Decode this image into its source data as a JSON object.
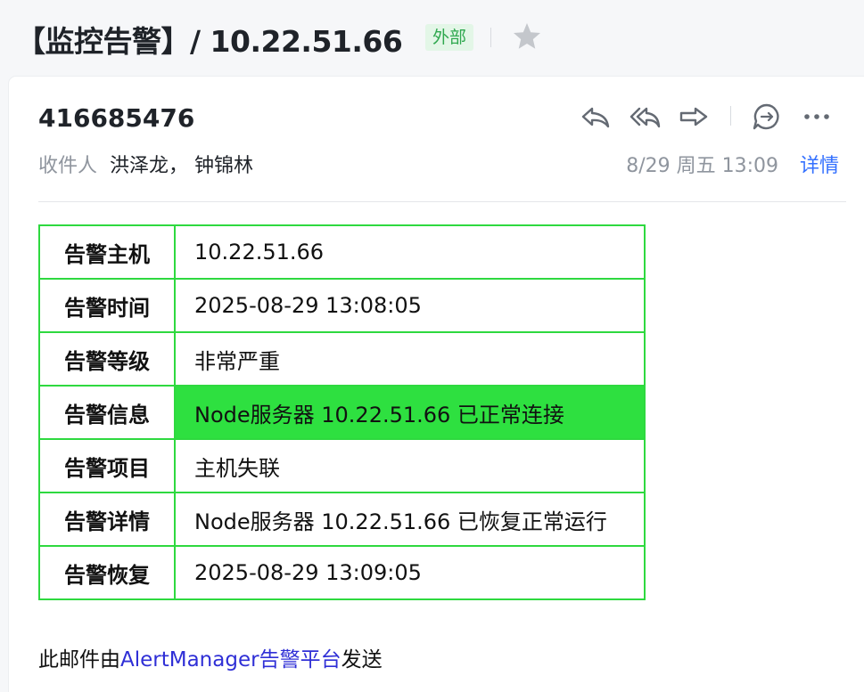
{
  "subject": {
    "title": "【监控告警】/ 10.22.51.66",
    "tag": "外部",
    "star_icon": "star-icon"
  },
  "header": {
    "sender": "416685476",
    "recipients_label": "收件人",
    "recipients": "洪泽龙， 钟锦林",
    "date": "8/29 周五 13:09",
    "details_link": "详情",
    "actions": [
      "reply-icon",
      "reply-all-icon",
      "forward-icon",
      "comment-icon",
      "more-icon"
    ]
  },
  "alert_table": {
    "rows": [
      {
        "key": "告警主机",
        "value": "10.22.51.66"
      },
      {
        "key": "告警时间",
        "value": "2025-08-29 13:08:05"
      },
      {
        "key": "告警等级",
        "value": "非常严重"
      },
      {
        "key": "告警信息",
        "value": "Node服务器 10.22.51.66 已正常连接"
      },
      {
        "key": "告警项目",
        "value": "主机失联"
      },
      {
        "key": "告警详情",
        "value": "Node服务器 10.22.51.66 已恢复正常运行"
      },
      {
        "key": "告警恢复",
        "value": "2025-08-29 13:09:05"
      }
    ],
    "border_color": "#2ed93f",
    "highlight_color": "#2ee040"
  },
  "footer": {
    "prefix": "此邮件由",
    "link": "AlertManager告警平台",
    "suffix": "发送"
  }
}
